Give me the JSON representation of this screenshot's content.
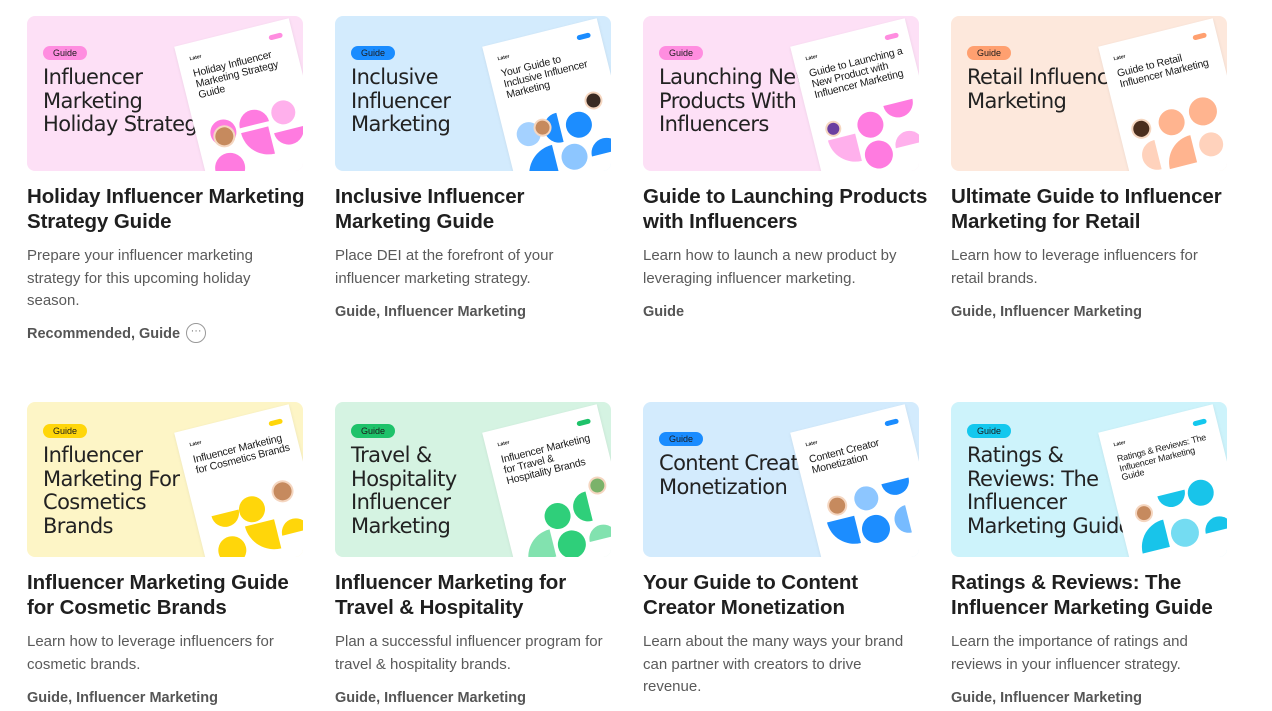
{
  "cards": [
    {
      "badge": "Guide",
      "thumb_title": "Influencer Marketing Holiday Strategy",
      "booklet_logo": "Later",
      "booklet_title": "Holiday Influencer Marketing Strategy Guide",
      "title": "Holiday Influencer Marketing Strategy Guide",
      "description": "Prepare your influencer marketing strategy for this upcoming holiday season.",
      "tags": "Recommended, Guide",
      "more_icon": "ellipsis-icon",
      "colors": {
        "bg": "#fde0f6",
        "badge": "#ff8de0",
        "accent": "#ff7be0"
      }
    },
    {
      "badge": "Guide",
      "thumb_title": "Inclusive Influencer Marketing",
      "booklet_logo": "Later",
      "booklet_title": "Your Guide to Inclusive Influencer Marketing",
      "title": "Inclusive Influencer Marketing Guide",
      "description": "Place DEI at the forefront of your influencer marketing strategy.",
      "tags": "Guide, Influencer Marketing",
      "colors": {
        "bg": "#d3ebfd",
        "badge": "#1a8cff",
        "accent": "#1c8dff"
      }
    },
    {
      "badge": "Guide",
      "thumb_title": "Launching New Products With Influencers",
      "booklet_logo": "Later",
      "booklet_title": "Guide to Launching a New Product with Influencer Marketing",
      "title": "Guide to Launching Products with Influencers",
      "description": "Learn how to launch a new product by leveraging influencer marketing.",
      "tags": "Guide",
      "colors": {
        "bg": "#fde0f6",
        "badge": "#ff8de0",
        "accent": "#ff7be0"
      }
    },
    {
      "badge": "Guide",
      "thumb_title": "Retail Influencer Marketing",
      "booklet_logo": "Later",
      "booklet_title": "Guide to Retail Influencer Marketing",
      "title": "Ultimate Guide to Influencer Marketing for Retail",
      "description": "Learn how to leverage influencers for retail brands.",
      "tags": "Guide, Influencer Marketing",
      "colors": {
        "bg": "#fde8dc",
        "badge": "#ffa070",
        "accent": "#ffb48f"
      }
    },
    {
      "badge": "Guide",
      "thumb_title": "Influencer Marketing For Cosmetics Brands",
      "booklet_logo": "Later",
      "booklet_title": "Influencer Marketing for Cosmetics Brands",
      "title": "Influencer Marketing Guide for Cosmetic Brands",
      "description": "Learn how to leverage influencers for cosmetic brands.",
      "tags": "Guide, Influencer Marketing",
      "colors": {
        "bg": "#fdf5c6",
        "badge": "#ffd60a",
        "accent": "#ffd60a"
      }
    },
    {
      "badge": "Guide",
      "thumb_title": "Travel & Hospitality Influencer Marketing",
      "booklet_logo": "Later",
      "booklet_title": "Influencer Marketing for Travel & Hospitality Brands",
      "title": "Influencer Marketing for Travel & Hospitality",
      "description": "Plan a successful influencer program for travel & hospitality brands.",
      "tags": "Guide, Influencer Marketing",
      "colors": {
        "bg": "#d5f3e2",
        "badge": "#1ec26a",
        "accent": "#2fcf7a"
      }
    },
    {
      "badge": "Guide",
      "thumb_title": "Content Creator Monetization",
      "booklet_logo": "Later",
      "booklet_title": "Content Creator Monetization",
      "title": "Your Guide to Content Creator Monetization",
      "description": "Learn about the many ways your brand can partner with creators to drive revenue.",
      "tags": "",
      "colors": {
        "bg": "#d3ebfd",
        "badge": "#1a8cff",
        "accent": "#1c8dff"
      }
    },
    {
      "badge": "Guide",
      "thumb_title": "Ratings & Reviews: The Influencer Marketing Guide",
      "booklet_logo": "Later",
      "booklet_title": "Ratings & Reviews: The Influencer Marketing Guide",
      "title": "Ratings & Reviews: The Influencer Marketing Guide",
      "description": "Learn the importance of ratings and reviews in your influencer strategy.",
      "tags": "Guide, Influencer Marketing",
      "colors": {
        "bg": "#cdf3fb",
        "badge": "#14c8ee",
        "accent": "#18c4ea"
      }
    }
  ]
}
